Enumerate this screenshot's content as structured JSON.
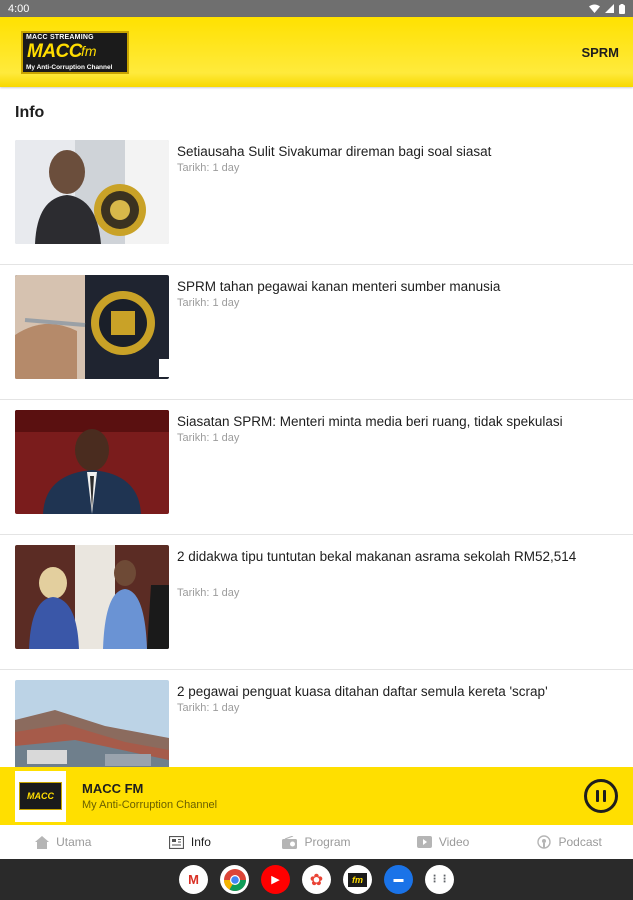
{
  "status_bar": {
    "time": "4:00"
  },
  "app_bar": {
    "logo": {
      "top_text": "MACC STREAMING",
      "main_text": "MACC",
      "fm_text": "fm",
      "sub_text": "My Anti-Corruption Channel"
    },
    "right_link": "SPRM"
  },
  "section_title": "Info",
  "articles": [
    {
      "title": "Setiausaha Sulit Sivakumar direman bagi soal siasat",
      "date": "Tarikh: 1 day",
      "image": "man-with-macc-emblem"
    },
    {
      "title": "SPRM tahan pegawai kanan menteri sumber manusia",
      "date": "Tarikh: 1 day",
      "image": "handcuffs-with-sprm-emblem"
    },
    {
      "title": "Siasatan SPRM: Menteri minta media beri ruang, tidak spekulasi",
      "date": "Tarikh: 1 day",
      "image": "minister-portrait"
    },
    {
      "title": "2 didakwa tipu tuntutan bekal makanan asrama sekolah RM52,514",
      "date": "Tarikh: 1 day",
      "image": "two-accused-walking"
    },
    {
      "title": "2 pegawai penguat kuasa ditahan daftar semula kereta 'scrap'",
      "date": "Tarikh: 1 day",
      "image": "scrap-car-yard"
    }
  ],
  "player": {
    "logo_text": "MACC",
    "title": "MACC FM",
    "subtitle": "My Anti-Corruption Channel",
    "state": "playing"
  },
  "bottom_nav": [
    {
      "label": "Utama",
      "icon": "home-icon",
      "active": false
    },
    {
      "label": "Info",
      "icon": "newspaper-icon",
      "active": true
    },
    {
      "label": "Program",
      "icon": "radio-icon",
      "active": false
    },
    {
      "label": "Video",
      "icon": "video-icon",
      "active": false
    },
    {
      "label": "Podcast",
      "icon": "podcast-icon",
      "active": false
    }
  ],
  "dock": {
    "apps": [
      {
        "name": "gmail-icon",
        "glyph": "M",
        "color": "#d93025"
      },
      {
        "name": "chrome-icon",
        "glyph": "",
        "color": "#4285f4"
      },
      {
        "name": "youtube-icon",
        "glyph": "▶",
        "color": "#ff0000"
      },
      {
        "name": "photos-icon",
        "glyph": "✿",
        "color": "#fbbc04"
      },
      {
        "name": "macc-fm-app-icon",
        "glyph": "fm",
        "color": "#1b1b1b"
      },
      {
        "name": "messages-icon",
        "glyph": "▬",
        "color": "#1a73e8"
      },
      {
        "name": "app-drawer-icon",
        "glyph": "⋮⋮",
        "color": "#5f6368"
      }
    ]
  },
  "colors": {
    "accent": "#ffdf00",
    "text": "#1e1e1e",
    "muted": "#9c9c9c"
  }
}
